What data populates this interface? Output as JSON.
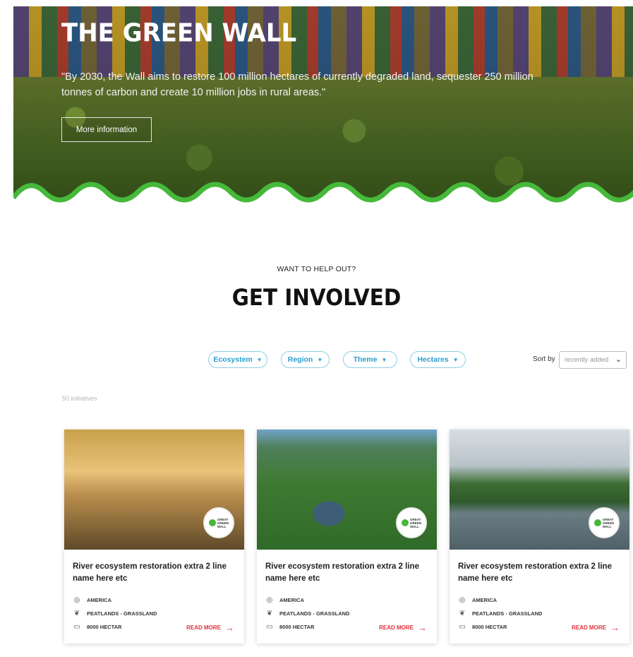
{
  "hero": {
    "title": "THE GREEN WALL",
    "quote": "\"By 2030, the Wall aims to restore 100 million hectares of currently degraded land, sequester 250 million tonnes of carbon and create 10 million jobs in rural areas.\"",
    "button_label": "More information"
  },
  "section": {
    "eyebrow": "WANT TO HELP OUT?",
    "headline": "GET INVOLVED"
  },
  "filters": [
    {
      "label": "Ecosystem",
      "icon": "caret-down-icon"
    },
    {
      "label": "Region",
      "icon": "caret-down-icon"
    },
    {
      "label": "Theme",
      "icon": "caret-down-icon"
    },
    {
      "label": "Hectares",
      "icon": "caret-down-icon"
    }
  ],
  "sort": {
    "label": "Sort by",
    "value": "recently added"
  },
  "results_count": "50 initiatives",
  "cards": [
    {
      "title": "River ecosystem restoration extra 2 line name here etc",
      "region": "AMERICA",
      "ecosystem": "PEATLANDS - GRASSLAND",
      "area": "8000 HECTAR",
      "read_more": "READ MORE",
      "badge": "GREAT GREEN WALL"
    },
    {
      "title": "River ecosystem restoration extra 2 line name here etc",
      "region": "AMERICA",
      "ecosystem": "PEATLANDS - GRASSLAND",
      "area": "8000 HECTAR",
      "read_more": "READ MORE",
      "badge": "GREAT GREEN WALL"
    },
    {
      "title": "River ecosystem restoration extra 2 line name here etc",
      "region": "AMERICA",
      "ecosystem": "PEATLANDS - GRASSLAND",
      "area": "8000 HECTAR",
      "read_more": "READ MORE",
      "badge": "GREAT GREEN WALL"
    }
  ],
  "colors": {
    "accent_green": "#46b83a",
    "filter_blue": "#2a9fd0",
    "read_more_red": "#e0313e"
  }
}
